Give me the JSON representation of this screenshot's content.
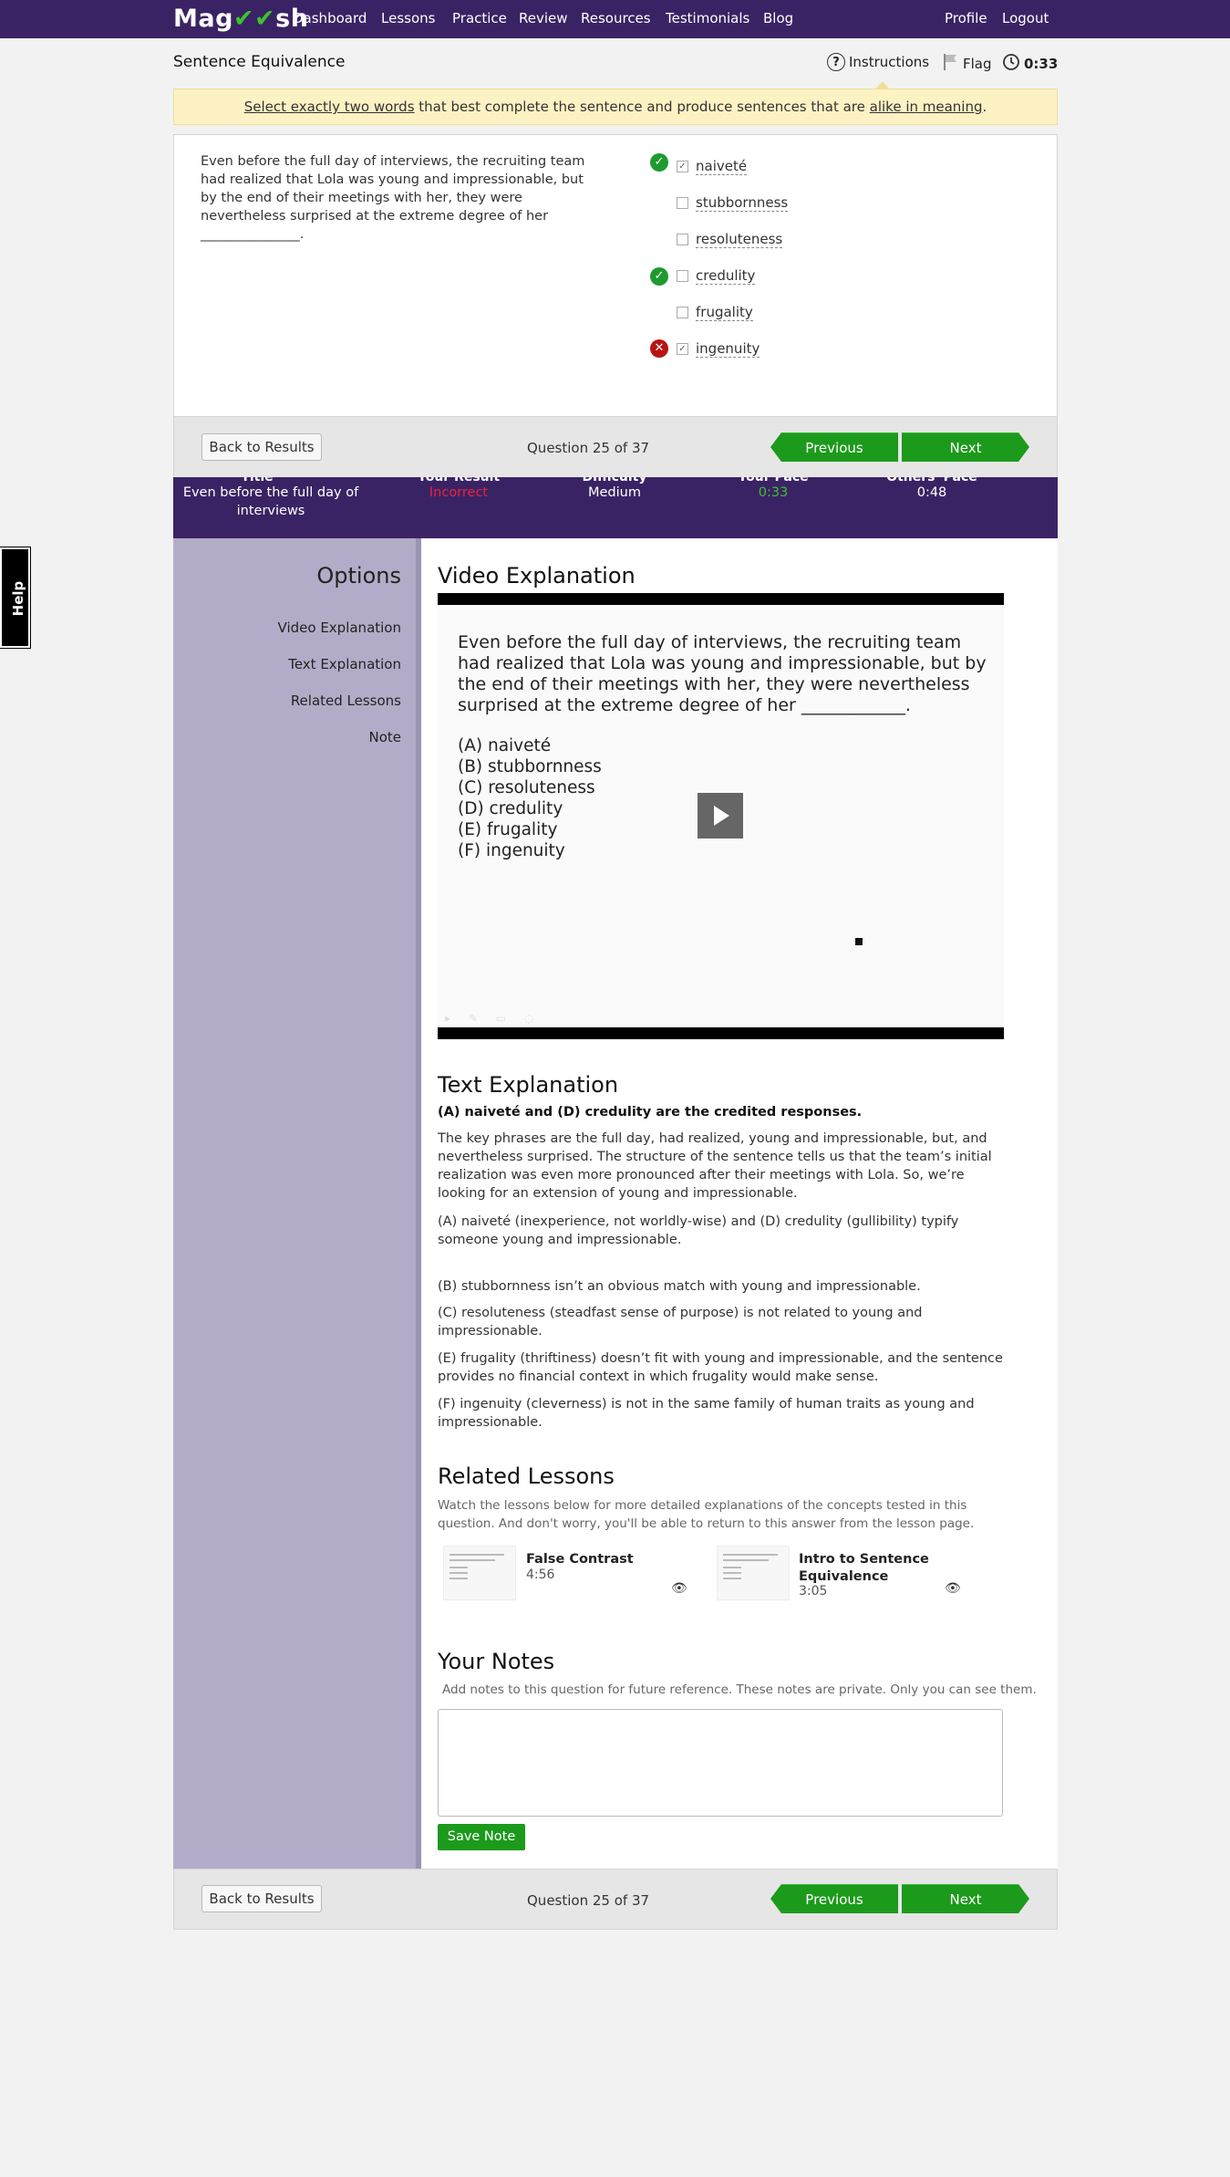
{
  "nav": {
    "logo": "Magoosh",
    "links": [
      "Dashboard",
      "Lessons",
      "Practice",
      "Review",
      "Resources",
      "Testimonials",
      "Blog"
    ],
    "right_links": [
      "Profile",
      "Logout"
    ]
  },
  "header": {
    "title": "Sentence Equivalence",
    "instructions_label": "Instructions",
    "flag_label": "Flag",
    "timer": "0:33"
  },
  "notice": {
    "part1": "Select exactly two words",
    "part2": " that best complete the sentence and produce sentences that are ",
    "part3": "alike in meaning",
    "part4": "."
  },
  "question": {
    "text": "Even before the full day of interviews, the recruiting team had realized that Lola was young and impressionable, but by the end of their meetings with her, they were nevertheless surprised at the extreme degree of her _______________.",
    "choices": [
      {
        "label": "naiveté",
        "checked": true,
        "result": "correct"
      },
      {
        "label": "stubbornness",
        "checked": false,
        "result": ""
      },
      {
        "label": "resoluteness",
        "checked": false,
        "result": ""
      },
      {
        "label": "credulity",
        "checked": false,
        "result": "correct"
      },
      {
        "label": "frugality",
        "checked": false,
        "result": ""
      },
      {
        "label": "ingenuity",
        "checked": true,
        "result": "incorrect"
      }
    ]
  },
  "footer": {
    "back_label": "Back to Results",
    "count": "Question 25 of 37",
    "prev_label": "Previous",
    "next_label": "Next"
  },
  "stats": {
    "headers": [
      "Title",
      "Your Result",
      "Difficulty",
      "Your Pace",
      "Others' Pace"
    ],
    "title_value": "Even before the full day of interviews",
    "result_value": "Incorrect",
    "difficulty_value": "Medium",
    "pace_value": "0:33",
    "others_pace_value": "0:48",
    "colors": {
      "incorrect": "#e8243c",
      "pace": "#3ec22b"
    }
  },
  "help_label": "Help",
  "options": {
    "title": "Options",
    "links": [
      "Video Explanation",
      "Text Explanation",
      "Related Lessons",
      "Note"
    ]
  },
  "video": {
    "heading": "Video Explanation",
    "slide_text": "Even before the full day of interviews, the recruiting team had realized that Lola was young and impressionable, but by the end of their meetings with her, they were nevertheless surprised at the extreme degree of her ____________.",
    "slide_options": [
      "(A) naiveté",
      "(B) stubbornness",
      "(C) resoluteness",
      "(D) credulity",
      "(E) frugality",
      "(F) ingenuity"
    ]
  },
  "text_explanation": {
    "heading": "Text Explanation",
    "credited": "(A) naiveté and (D) credulity are the credited responses.",
    "paragraphs": [
      "The key phrases are the full day, had realized, young and impressionable, but, and nevertheless surprised. The structure of the sentence tells us that the team’s initial realization was even more pronounced after their meetings with Lola. So, we’re looking for an extension of young and impressionable.",
      "(A) naiveté (inexperience, not worldly-wise) and (D) credulity (gullibility) typify someone young and impressionable.",
      "(B) stubbornness isn’t an obvious match with young and impressionable.",
      "(C) resoluteness (steadfast sense of purpose) is not related to young and impressionable.",
      "(E) frugality (thriftiness) doesn’t fit with young and impressionable, and the sentence provides no financial context in which frugality would make sense.",
      "(F) ingenuity (cleverness) is not in the same family of human traits as young and impressionable."
    ]
  },
  "related": {
    "heading": "Related Lessons",
    "intro": "Watch the lessons below for more detailed explanations of the concepts tested in this question. And don't worry, you'll be able to return to this answer from the lesson page.",
    "lessons": [
      {
        "title": "False Contrast",
        "time": "4:56"
      },
      {
        "title": "Intro to Sentence Equivalence",
        "time": "3:05"
      }
    ]
  },
  "notes": {
    "heading": "Your Notes",
    "intro": "Add notes to this question for future reference. These notes are private. Only you can see them.",
    "value": "",
    "save_label": "Save Note"
  }
}
